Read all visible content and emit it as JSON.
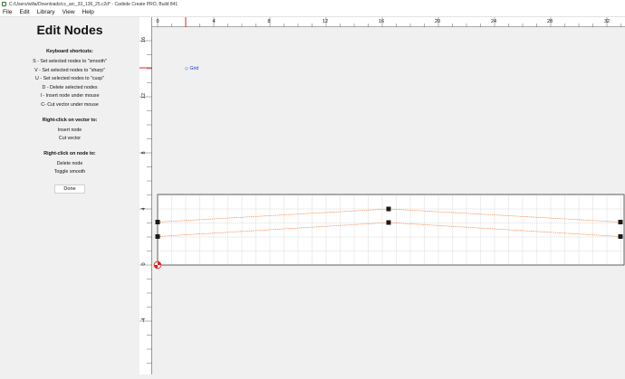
{
  "window": {
    "title": "C:/Users/willa/Downloads/cc_arc_33_136_25.c2d* - Carbide Create PRO, Build 841"
  },
  "menu": [
    "File",
    "Edit",
    "Library",
    "View",
    "Help"
  ],
  "panel": {
    "title": "Edit Nodes",
    "keyboard_heading": "Keyboard shortcuts:",
    "keyboard_shortcuts": [
      "S - Set selected nodes to \"smooth\"",
      "V - Set selected nodes to \"sharp\"",
      "U - Set selected nodes to \"cusp\"",
      "D - Delete selected nodes",
      "I - Insert node under mouse",
      "C- Cut vector under mouse"
    ],
    "vector_heading": "Right-click on vector to:",
    "vector_actions": [
      "Insert node",
      "Cut vector"
    ],
    "node_heading": "Right-click on node to:",
    "node_actions": [
      "Delete node",
      "Toggle smooth"
    ],
    "done_label": "Done"
  },
  "canvas": {
    "grid_label": "Grid",
    "ruler_x_labels": [
      "0",
      "4",
      "8",
      "12",
      "16",
      "20",
      "24",
      "28",
      "32"
    ],
    "ruler_y_labels": [
      "16",
      "12",
      "8",
      "4",
      "0",
      "-4"
    ],
    "colors": {
      "ruler_marker": "#e02020",
      "vector": "#f08c50",
      "node": "#1a1a1a",
      "grid_label": "#1a3ccc",
      "origin": "#e02020"
    }
  }
}
